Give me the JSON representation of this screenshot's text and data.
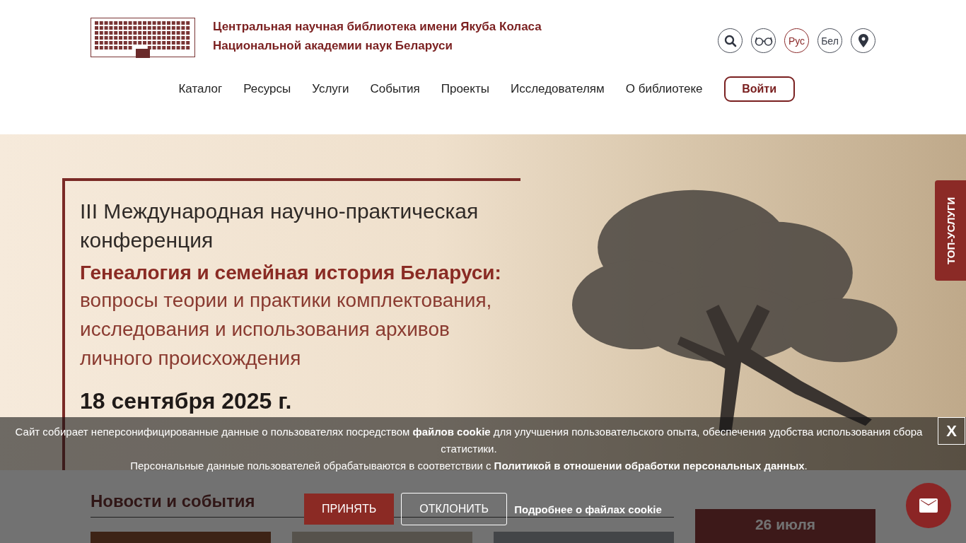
{
  "header": {
    "title_lines": [
      "Центральная научная библиотека имени Якуба Коласа",
      "Национальной академии наук Беларуси"
    ],
    "languages": [
      {
        "label": "Рус",
        "selected": true
      },
      {
        "label": "Бел",
        "selected": false
      }
    ]
  },
  "nav": {
    "items": [
      "Каталог",
      "Ресурсы",
      "Услуги",
      "События",
      "Проекты",
      "Исследователям",
      "О библиотеке"
    ],
    "login": "Войти"
  },
  "banner": {
    "intro": "III Международная научно-практическая конференция",
    "title": "Генеалогия и семейная история Беларуси:",
    "subtitle": "вопросы теории и практики комплектования, исследования и использования архивов личного происхождения",
    "date": "18 сентября 2025 г.",
    "side_tab": "ТОП-УСЛУГИ"
  },
  "news": {
    "heading": "Новости и события",
    "date_card": "26 июля"
  },
  "cookie": {
    "text": "Сайт собирает неперсонифицированные данные о пользователях посредством **файлов cookie** для улучшения пользовательского опыта, обеспечения удобства использования сбора статистики.",
    "policy": "Персональные данные пользователей обрабатываются в соответствии с **Политикой в отношении обработки персональных данных**.",
    "close": "X",
    "accept": "ПРИНЯТЬ",
    "decline": "ОТКЛОНИТЬ",
    "more": "Подробнее о файлах cookie"
  }
}
